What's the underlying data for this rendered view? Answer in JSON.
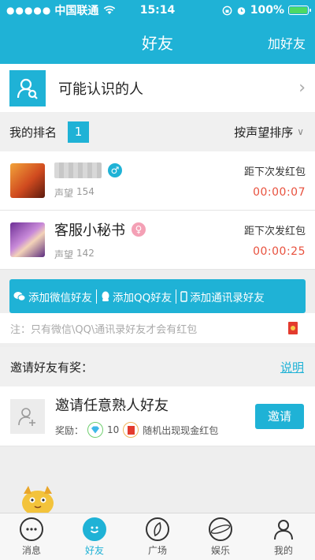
{
  "status_bar": {
    "signal": "●●●●●",
    "carrier": "中国联通",
    "time": "15:14",
    "battery": "100%",
    "battery_level": 1.0
  },
  "nav": {
    "title": "好友",
    "add_friend": "加好友"
  },
  "suggest": {
    "label": "可能认识的人"
  },
  "ranking": {
    "label": "我的排名",
    "rank": "1",
    "sort_label": "按声望排序"
  },
  "friends": [
    {
      "name_label": "",
      "gender": "male",
      "gender_symbol": "♂",
      "score_label": "声望",
      "score": "154",
      "caption": "距下次发红包",
      "timer": "00:00:07"
    },
    {
      "name_label": "客服小秘书",
      "gender": "female",
      "gender_symbol": "♀",
      "score_label": "声望",
      "score": "142",
      "caption": "距下次发红包",
      "timer": "00:00:25"
    }
  ],
  "add_strip": {
    "wechat": "添加微信好友",
    "qq": "添加QQ好友",
    "contacts": "添加通讯录好友"
  },
  "note": "注：只有微信\\QQ\\通讯录好友才会有红包",
  "invite": {
    "header": "邀请好友有奖：",
    "explain": "说明",
    "title": "邀请任意熟人好友",
    "reward_label": "奖励：",
    "gem_count": "10",
    "redpacket_text": "随机出现现金红包",
    "button": "邀请"
  },
  "tabs": [
    {
      "label": "消息",
      "icon": "message-icon"
    },
    {
      "label": "好友",
      "icon": "friends-icon",
      "active": true
    },
    {
      "label": "广场",
      "icon": "plaza-icon"
    },
    {
      "label": "娱乐",
      "icon": "planet-icon"
    },
    {
      "label": "我的",
      "icon": "profile-icon"
    }
  ],
  "colors": {
    "accent": "#1fb2d6",
    "timer": "#e8513e"
  }
}
